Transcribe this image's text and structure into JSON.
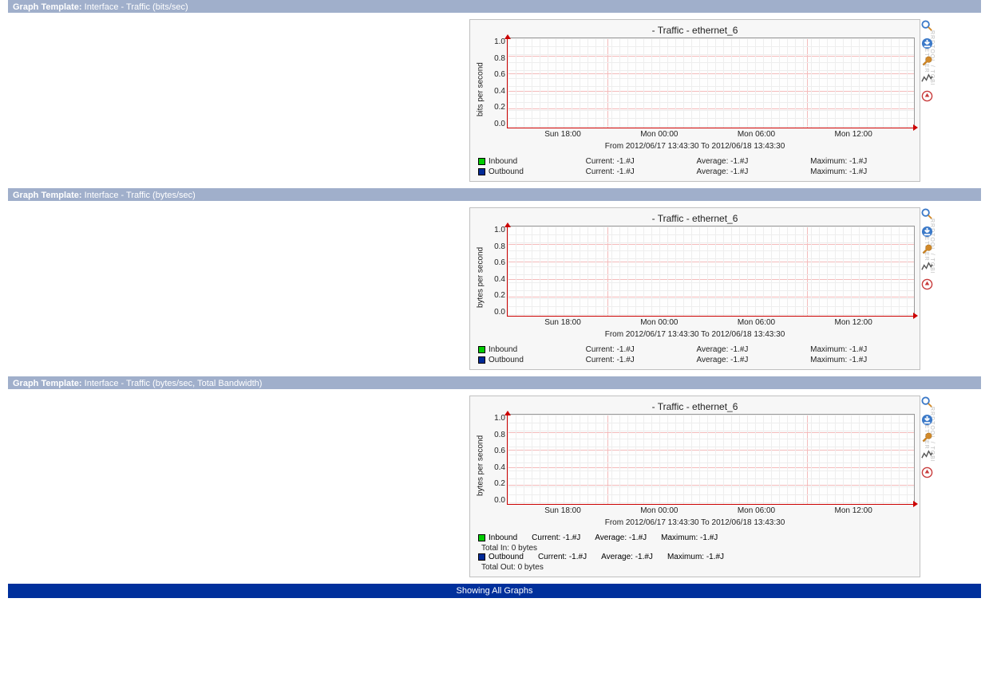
{
  "footer": {
    "text": "Showing All Graphs"
  },
  "header_label": "Graph Template:",
  "icons": {
    "zoom": "zoom-icon",
    "csv": "download-csv-icon",
    "wrench": "wrench-icon",
    "realtime": "realtime-icon",
    "pageup": "page-top-icon"
  },
  "side_tool_text": "RRDTOOL / TOBI OETIKER",
  "sections": [
    {
      "id": "s1",
      "header_value": "Interface - Traffic (bits/sec)",
      "title": " - Traffic - ethernet_6",
      "ylabel": "bits per second",
      "yticks": [
        "1.0",
        "0.8",
        "0.6",
        "0.4",
        "0.2",
        "0.0"
      ],
      "xticks": [
        "Sun 18:00",
        "Mon 00:00",
        "Mon 06:00",
        "Mon 12:00"
      ],
      "timerange": "From 2012/06/17 13:43:30 To 2012/06/18 13:43:30",
      "legend": [
        {
          "label": "Inbound",
          "color": "#00cc00",
          "current": "Current:  -1.#J",
          "average": "Average:  -1.#J",
          "maximum": "Maximum:  -1.#J"
        },
        {
          "label": "Outbound",
          "color": "#002a97",
          "current": "Current:  -1.#J",
          "average": "Average:  -1.#J",
          "maximum": "Maximum:  -1.#J"
        }
      ],
      "extras": []
    },
    {
      "id": "s2",
      "header_value": "Interface - Traffic (bytes/sec)",
      "title": " - Traffic - ethernet_6",
      "ylabel": "bytes per second",
      "yticks": [
        "1.0",
        "0.8",
        "0.6",
        "0.4",
        "0.2",
        "0.0"
      ],
      "xticks": [
        "Sun 18:00",
        "Mon 00:00",
        "Mon 06:00",
        "Mon 12:00"
      ],
      "timerange": "From 2012/06/17 13:43:30 To 2012/06/18 13:43:30",
      "legend": [
        {
          "label": "Inbound",
          "color": "#00cc00",
          "current": "Current:  -1.#J",
          "average": "Average:  -1.#J",
          "maximum": "Maximum:  -1.#J"
        },
        {
          "label": "Outbound",
          "color": "#002a97",
          "current": "Current:  -1.#J",
          "average": "Average:  -1.#J",
          "maximum": "Maximum:  -1.#J"
        }
      ],
      "extras": []
    },
    {
      "id": "s3",
      "header_value": "Interface - Traffic (bytes/sec, Total Bandwidth)",
      "title": " - Traffic - ethernet_6",
      "ylabel": "bytes per second",
      "yticks": [
        "1.0",
        "0.8",
        "0.6",
        "0.4",
        "0.2",
        "0.0"
      ],
      "xticks": [
        "Sun 18:00",
        "Mon 00:00",
        "Mon 06:00",
        "Mon 12:00"
      ],
      "timerange": "From 2012/06/17 13:43:30 To 2012/06/18 13:43:30",
      "legend": [
        {
          "label": "Inbound",
          "color": "#00cc00",
          "current": "Current:  -1.#J",
          "average": "Average:  -1.#J",
          "maximum": "Maximum:  -1.#J"
        },
        {
          "label": "Outbound",
          "color": "#002a97",
          "current": "Current:  -1.#J",
          "average": "Average:  -1.#J",
          "maximum": "Maximum:  -1.#J"
        }
      ],
      "extras": [
        "Total In:  0 bytes",
        "Total Out: 0 bytes"
      ]
    }
  ],
  "chart_data": [
    {
      "type": "line",
      "title": " - Traffic - ethernet_6",
      "xlabel": "",
      "ylabel": "bits per second",
      "ylim": [
        0,
        1
      ],
      "x": [
        "Sun 18:00",
        "Mon 00:00",
        "Mon 06:00",
        "Mon 12:00"
      ],
      "series": [
        {
          "name": "Inbound",
          "values": []
        },
        {
          "name": "Outbound",
          "values": []
        }
      ],
      "x_range": "2012/06/17 13:43:30 to 2012/06/18 13:43:30"
    },
    {
      "type": "line",
      "title": " - Traffic - ethernet_6",
      "xlabel": "",
      "ylabel": "bytes per second",
      "ylim": [
        0,
        1
      ],
      "x": [
        "Sun 18:00",
        "Mon 00:00",
        "Mon 06:00",
        "Mon 12:00"
      ],
      "series": [
        {
          "name": "Inbound",
          "values": []
        },
        {
          "name": "Outbound",
          "values": []
        }
      ],
      "x_range": "2012/06/17 13:43:30 to 2012/06/18 13:43:30"
    },
    {
      "type": "line",
      "title": " - Traffic - ethernet_6",
      "xlabel": "",
      "ylabel": "bytes per second",
      "ylim": [
        0,
        1
      ],
      "x": [
        "Sun 18:00",
        "Mon 00:00",
        "Mon 06:00",
        "Mon 12:00"
      ],
      "series": [
        {
          "name": "Inbound",
          "values": []
        },
        {
          "name": "Outbound",
          "values": []
        }
      ],
      "x_range": "2012/06/17 13:43:30 to 2012/06/18 13:43:30",
      "totals": {
        "in": "0 bytes",
        "out": "0 bytes"
      }
    }
  ]
}
